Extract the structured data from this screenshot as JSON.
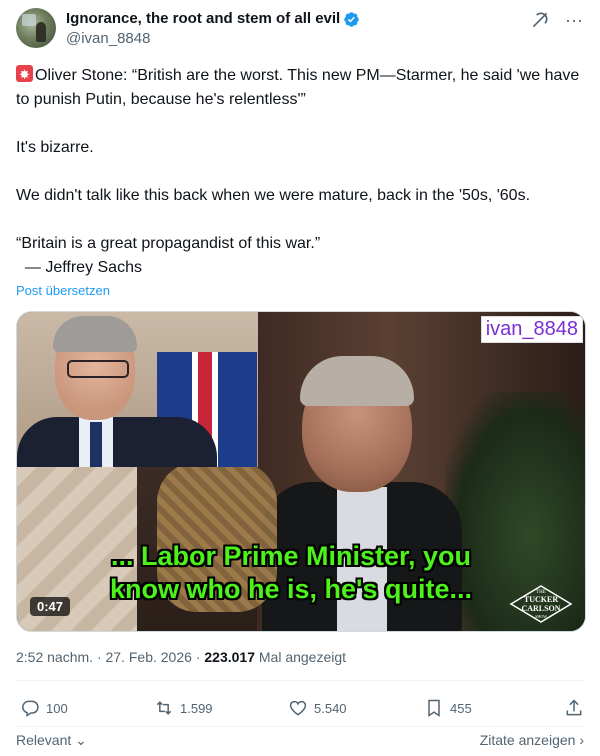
{
  "author": {
    "name": "Ignorance, the root and stem of all evil",
    "handle": "@ivan_8848",
    "verified_icon": "verified-badge-icon"
  },
  "header_icons": [
    "grok-icon",
    "more-icon"
  ],
  "tweet": {
    "line1": "Oliver Stone: “British are the worst. This new PM—Starmer, he said 'we have to punish Putin, because he's relentless'”",
    "line2": "It's bizarre.",
    "line3": "We didn't talk like this back when we were mature, back in the '50s, '60s.",
    "line4": "“Britain is a great propagandist of this war.”",
    "line5": "  — Jeffrey Sachs"
  },
  "translate_link": "Post übersetzen",
  "media": {
    "watermark": "ivan_8848",
    "caption_line1": "... Labor Prime Minister, you",
    "caption_line2": "know who he is, he's quite...",
    "duration": "0:47",
    "show_logo_text_1": "THE",
    "show_logo_text_2": "TUCKER",
    "show_logo_text_3": "CARLSON",
    "show_logo_text_4": "SHOW"
  },
  "meta": {
    "time": "2:52 nachm.",
    "date": "27. Feb. 2026",
    "views_count": "223.017",
    "views_label": "Mal angezeigt",
    "separator": "·"
  },
  "actions": {
    "replies": "100",
    "reposts": "1.599",
    "likes": "5.540",
    "bookmarks": "455"
  },
  "footer": {
    "relevant": "Relevant",
    "quotes": "Zitate anzeigen"
  },
  "colors": {
    "accent": "#1d9bf0",
    "caption_green": "#4cf21a",
    "watermark_purple": "#7b2fd2"
  }
}
